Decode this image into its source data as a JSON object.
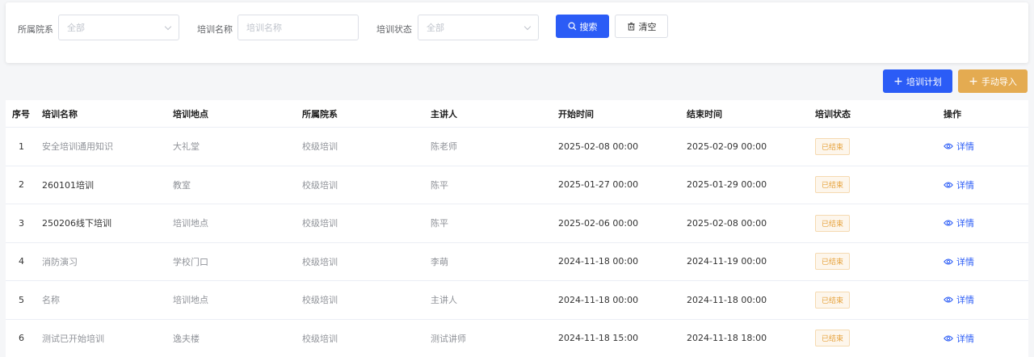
{
  "filters": {
    "department": {
      "label": "所属院系",
      "value": "全部"
    },
    "name": {
      "label": "培训名称",
      "placeholder": "培训名称"
    },
    "status": {
      "label": "培训状态",
      "value": "全部"
    },
    "search_label": "搜索",
    "clear_label": "清空"
  },
  "actions": {
    "plan_label": "培训计划",
    "import_label": "手动导入"
  },
  "table": {
    "headers": [
      "序号",
      "培训名称",
      "培训地点",
      "所属院系",
      "主讲人",
      "开始时间",
      "结束时间",
      "培训状态",
      "操作"
    ],
    "rows": [
      {
        "index": "1",
        "name": "安全培训通用知识",
        "location": "大礼堂",
        "department": "校级培训",
        "speaker": "陈老师",
        "start": "2025-02-08 00:00",
        "end": "2025-02-09 00:00",
        "status": "已结束",
        "action": "详情"
      },
      {
        "index": "2",
        "name": "260101培训",
        "location": "教室",
        "department": "校级培训",
        "speaker": "陈平",
        "start": "2025-01-27 00:00",
        "end": "2025-01-29 00:00",
        "status": "已结束",
        "action": "详情"
      },
      {
        "index": "3",
        "name": "250206线下培训",
        "location": "培训地点",
        "department": "校级培训",
        "speaker": "陈平",
        "start": "2025-02-06 00:00",
        "end": "2025-02-08 00:00",
        "status": "已结束",
        "action": "详情"
      },
      {
        "index": "4",
        "name": "消防演习",
        "location": "学校门口",
        "department": "校级培训",
        "speaker": "李萌",
        "start": "2024-11-18 00:00",
        "end": "2024-11-19 00:00",
        "status": "已结束",
        "action": "详情"
      },
      {
        "index": "5",
        "name": "名称",
        "location": "培训地点",
        "department": "校级培训",
        "speaker": "主讲人",
        "start": "2024-11-18 00:00",
        "end": "2024-11-18 00:00",
        "status": "已结束",
        "action": "详情"
      },
      {
        "index": "6",
        "name": "测试已开始培训",
        "location": "逸夫楼",
        "department": "校级培训",
        "speaker": "测试讲师",
        "start": "2024-11-18 15:00",
        "end": "2024-11-18 18:00",
        "status": "已结束",
        "action": "详情"
      }
    ]
  },
  "colors": {
    "primary": "#2b5cf6",
    "warning": "#e4ab51",
    "status_badge": "#e6a23c"
  }
}
